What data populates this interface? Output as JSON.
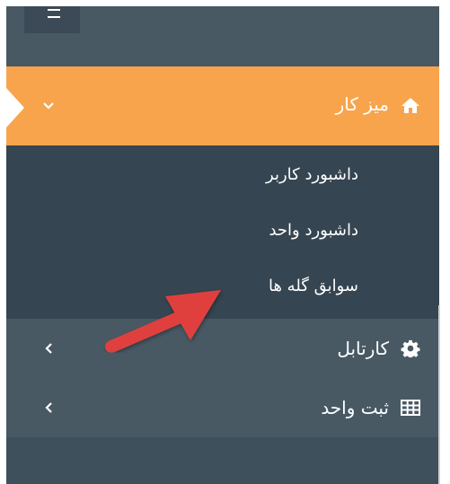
{
  "colors": {
    "sidebar_bg": "#3f505d",
    "menu_item_bg": "#485964",
    "active_bg": "#f8a44d",
    "submenu_bg": "#354551",
    "annotation_arrow": "#e0403d"
  },
  "sidebar": {
    "toggle_icon": "hamburger-icon",
    "active_menu": {
      "label": "میز کار",
      "icon": "home-icon",
      "expanded_icon": "chevron-down-icon",
      "submenu": [
        {
          "label": "داشبورد کاربر"
        },
        {
          "label": "داشبورد واحد"
        },
        {
          "label": "سوابق گله ها"
        }
      ]
    },
    "items": [
      {
        "label": "کارتابل",
        "icon": "gear-icon",
        "chevron": "chevron-left-icon"
      },
      {
        "label": "ثبت واحد",
        "icon": "table-icon",
        "chevron": "chevron-left-icon"
      }
    ]
  }
}
